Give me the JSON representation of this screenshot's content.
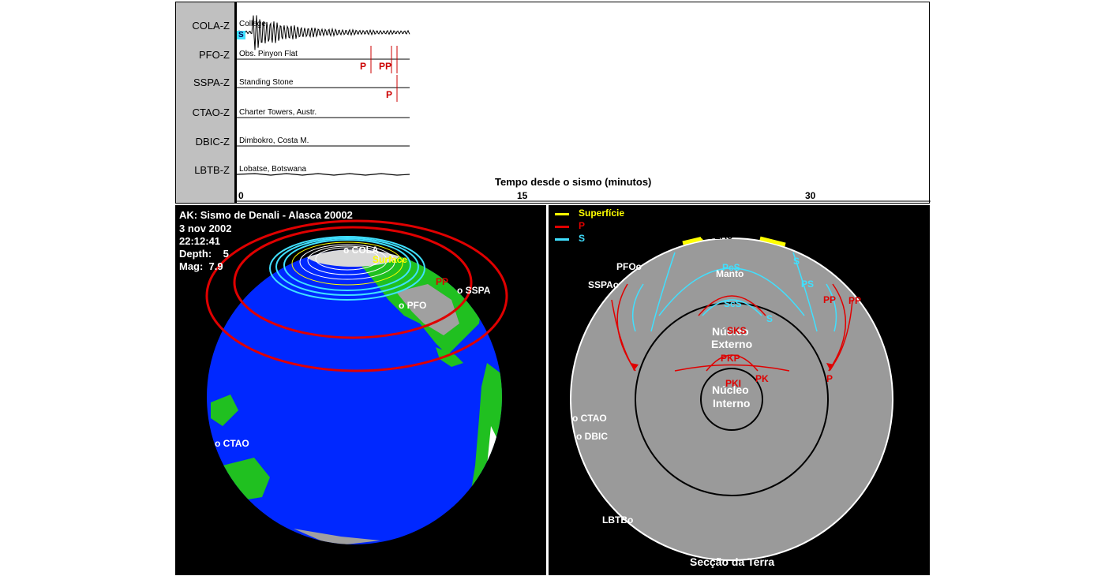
{
  "seismogram": {
    "stations": [
      {
        "code": "COLA-Z",
        "name": "College"
      },
      {
        "code": "PFO-Z",
        "name": "Obs. Pinyon Flat"
      },
      {
        "code": "SSPA-Z",
        "name": "Standing Stone"
      },
      {
        "code": "CTAO-Z",
        "name": "Charter Towers, Austr."
      },
      {
        "code": "DBIC-Z",
        "name": "Dimbokro, Costa M."
      },
      {
        "code": "LBTB-Z",
        "name": "Lobatse, Botswana"
      }
    ],
    "axis_title": "Tempo desde o sismo (minutos)",
    "ticks": [
      "0",
      "15",
      "30"
    ],
    "phase_marks": {
      "cola": "S",
      "pfo_p": "P",
      "pfo_pp": "PP",
      "sspa_p": "P"
    }
  },
  "globe": {
    "title": "AK: Sismo de Denali - Alasca 20002",
    "date": "3 nov 2002",
    "time": "22:12:41",
    "depth": "Depth:    5",
    "mag": "Mag:  7.9",
    "labels": {
      "cola": "o COLA",
      "surface": "Surface",
      "pp": "PP",
      "sspa": "o SSPA",
      "pfo": "o PFO",
      "ctao": "o CTAO"
    }
  },
  "section": {
    "legend": {
      "surface": "Superfície",
      "p": "P",
      "s": "S"
    },
    "stations": {
      "cola": "COLAo",
      "pfo": "PFOo",
      "sspa": "SSPAo",
      "ctao": "o CTAO",
      "dbic": "o DBIC",
      "lbtb": "LBTBo"
    },
    "layers": {
      "mantle": "Manto",
      "outer_core_1": "Núcleo",
      "outer_core_2": "Externo",
      "inner_core_1": "Núcleo",
      "inner_core_2": "Interno"
    },
    "phases": {
      "pcs": "PcS",
      "scs": "ScS",
      "ps": "PS",
      "s1": "S",
      "s2": "S",
      "pp1": "PP",
      "pp2": "PP",
      "p": "P",
      "sks": "SKS",
      "pkp": "PKP",
      "pki": "PKI",
      "pk": "PK"
    },
    "caption": "Secção da Terra"
  },
  "colors": {
    "ocean": "#0028ff",
    "land": "#20c020",
    "pwave": "#e00000",
    "swave": "#40e0ff",
    "surface": "#ffff00",
    "section": "#9a9a9a"
  }
}
